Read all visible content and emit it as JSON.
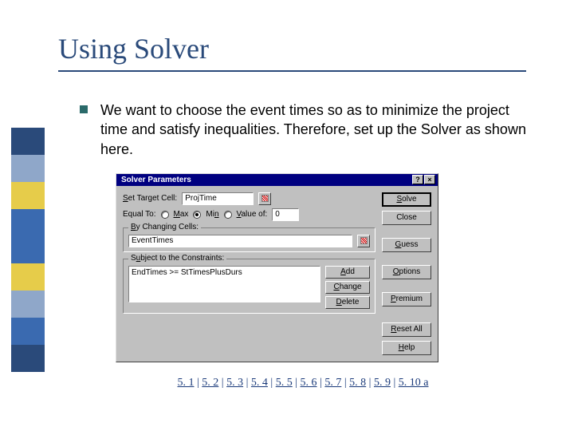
{
  "slide": {
    "title": "Using Solver",
    "body_text": "We want to choose the event times so as to minimize the project time and satisfy inequalities. Therefore, set up the Solver as shown here."
  },
  "dialog": {
    "title": "Solver Parameters",
    "labels": {
      "target": "Set Target Cell:",
      "equal_to": "Equal To:",
      "max": "Max",
      "min": "Min",
      "value_of": "Value of:",
      "value_of_val": "0",
      "by_changing": "By Changing Cells:",
      "subject_to": "Subject to the Constraints:"
    },
    "target_cell": "ProjTime",
    "equal_to_selected": "min",
    "changing_cells": "EventTimes",
    "constraints": [
      "EndTimes >= StTimesPlusDurs"
    ],
    "buttons": {
      "solve": "Solve",
      "close": "Close",
      "guess": "Guess",
      "options": "Options",
      "premium": "Premium",
      "add": "Add",
      "change": "Change",
      "delete": "Delete",
      "reset_all": "Reset All",
      "help": "Help"
    }
  },
  "footer": {
    "links": [
      "5. 1",
      "5. 2",
      "5. 3",
      "5. 4",
      "5. 5",
      "5. 6",
      "5. 7",
      "5. 8",
      "5. 9",
      "5. 10 a"
    ]
  }
}
